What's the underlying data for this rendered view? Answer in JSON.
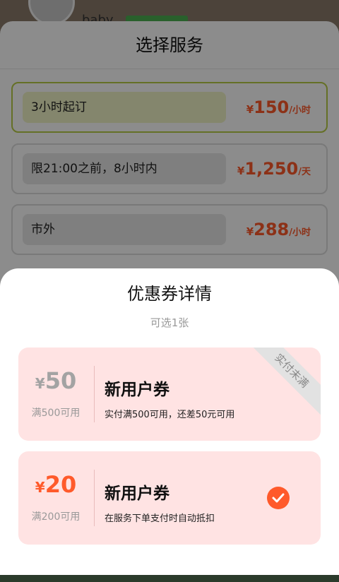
{
  "background": {
    "profile_name": "baby",
    "sheet_title": "选择服务",
    "options": [
      {
        "label": "3小时起订",
        "currency": "¥",
        "price": "150",
        "unit": "/小时",
        "selected": true
      },
      {
        "label": "限21:00之前，8小时内",
        "currency": "¥",
        "price": "1,250",
        "unit": "/天",
        "selected": false
      },
      {
        "label": "市外",
        "currency": "¥",
        "price": "288",
        "unit": "/小时",
        "selected": false
      }
    ]
  },
  "modal": {
    "title": "优惠券详情",
    "subtitle": "可选1张",
    "coupons": [
      {
        "currency": "¥",
        "amount": "50",
        "condition": "满500可用",
        "name": "新用户券",
        "description": "实付满500可用，还差50元可用",
        "ribbon": "实付未满",
        "state": "disabled"
      },
      {
        "currency": "¥",
        "amount": "20",
        "condition": "满200可用",
        "name": "新用户券",
        "description": "在服务下单支付时自动抵扣",
        "state": "selected"
      }
    ]
  },
  "colors": {
    "accent": "#ff5a2b",
    "selected_border": "#b8cc46",
    "coupon_bg": "#ffe3e3"
  }
}
